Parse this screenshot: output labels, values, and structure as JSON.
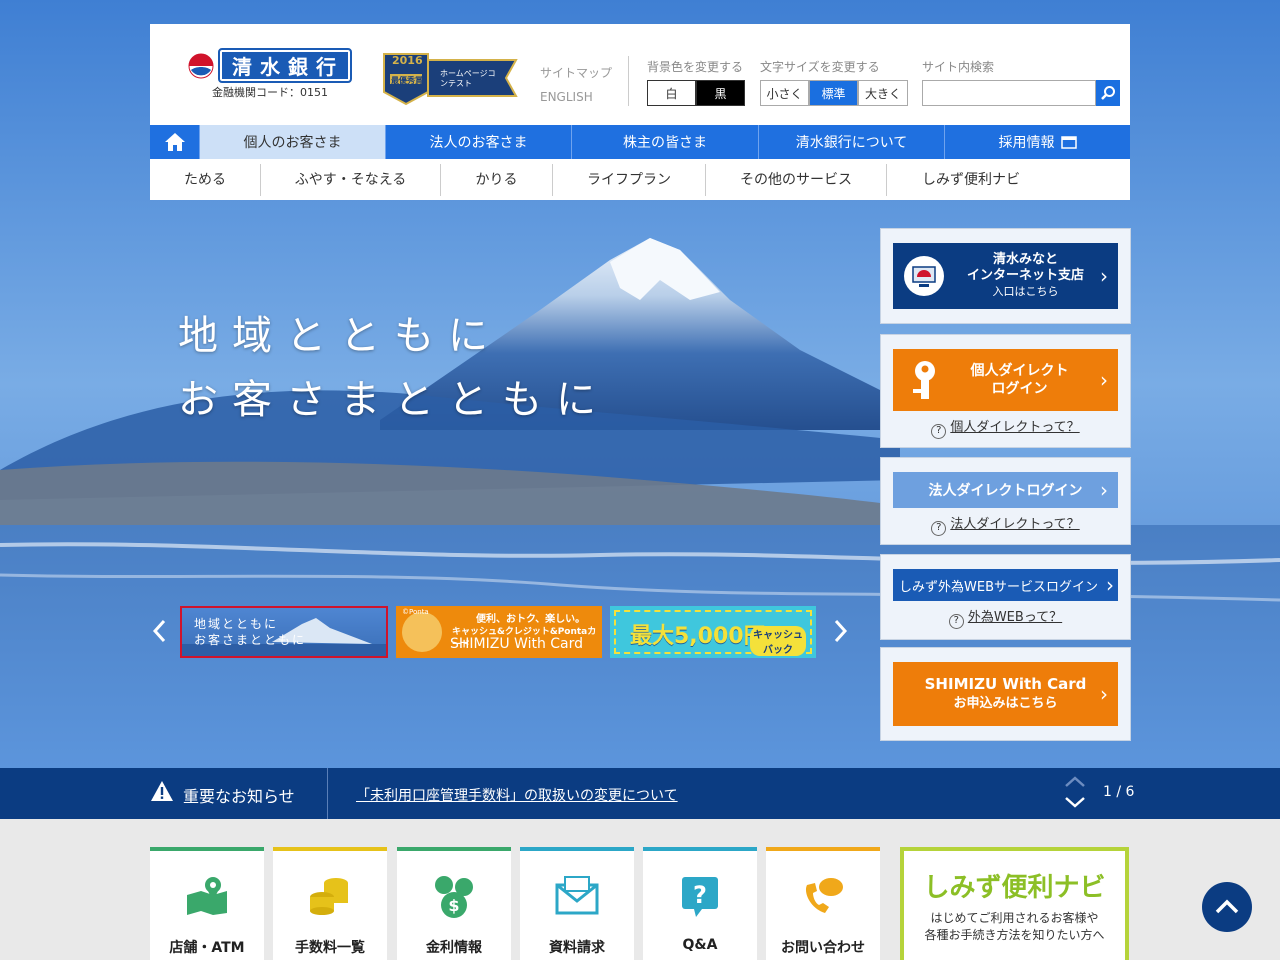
{
  "header": {
    "logo_text": "清水銀行",
    "bank_code": "金融機関コード：0151",
    "award_year": "2016",
    "award_text": "ホームページコンテスト",
    "award_badge": "最優秀賞",
    "sitemap": "サイトマップ",
    "english": "ENGLISH",
    "bg_color_label": "背景色を変更する",
    "bg_white": "白",
    "bg_black": "黒",
    "font_size_label": "文字サイズを変更する",
    "size_small": "小さく",
    "size_normal": "標準",
    "size_large": "大きく",
    "search_label": "サイト内検索",
    "search_placeholder": ""
  },
  "gnav": {
    "items": [
      "個人のお客さま",
      "法人のお客さま",
      "株主の皆さま",
      "清水銀行について",
      "採用情報"
    ]
  },
  "subnav": {
    "items": [
      "ためる",
      "ふやす・そなえる",
      "かりる",
      "ライフプラン",
      "その他のサービス",
      "しみず便利ナビ"
    ]
  },
  "hero": {
    "line1": "地域とともに",
    "line2": "お客さまとともに"
  },
  "carousel": {
    "thumb1_line1": "地域とともに",
    "thumb1_line2": "お客さまとともに",
    "thumb2_top": "便利、おトク、楽しい。",
    "thumb2_mid": "キャッシュ&クレジット&Pontaカード",
    "thumb2_brand": "SHIMIZU With Card",
    "thumb2_ponta": "©Ponta",
    "thumb3_main": "最大5,000円",
    "thumb3_sub": "キャッシュバック"
  },
  "side": {
    "minato_line1": "清水みなと",
    "minato_line2": "インターネット支店",
    "minato_line3": "入口はこちら",
    "personal_line1": "個人ダイレクト",
    "personal_line2": "ログイン",
    "personal_q": "個人ダイレクトって？",
    "corp_login": "法人ダイレクトログイン",
    "corp_q": "法人ダイレクトって？",
    "fx_login": "しみず外為WEBサービスログイン",
    "fx_q": "外為WEBって？",
    "card_line1": "SHIMIZU With Card",
    "card_line2": "お申込みはこちら"
  },
  "notice": {
    "label": "重要なお知らせ",
    "link": "「未利用口座管理手数料」の取扱いの変更について",
    "pager": "1 / 6"
  },
  "tiles": [
    {
      "label": "店舗・ATM",
      "color": "#3aa86b"
    },
    {
      "label": "手数料一覧",
      "color": "#e6c21a"
    },
    {
      "label": "金利情報",
      "color": "#3aa86b"
    },
    {
      "label": "資料請求",
      "color": "#2ca7c7"
    },
    {
      "label": "Q&A",
      "color": "#2ca7c7"
    },
    {
      "label": "お問い合わせ",
      "color": "#f0a81a"
    }
  ],
  "navi": {
    "title": "しみず便利ナビ",
    "desc1": "はじめてご利用されるお客様や",
    "desc2": "各種お手続き方法を知りたい方へ"
  },
  "colors": {
    "accent": "#1f70e0",
    "navy": "#0b3c82",
    "orange": "#ee7d0a"
  }
}
